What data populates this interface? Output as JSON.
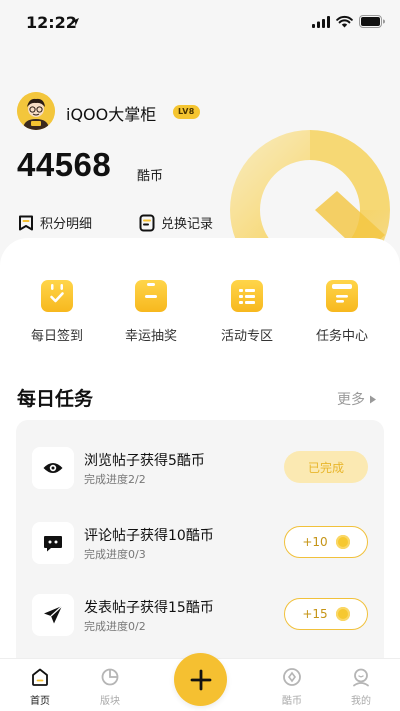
{
  "status_bar": {
    "time": "12:22"
  },
  "profile": {
    "username": "iQOO大掌柜",
    "level_badge": "LV8",
    "coin_balance": "44568",
    "coin_unit": "酷币"
  },
  "quick_links": {
    "points_detail": "积分明细",
    "redeem_history": "兑换记录"
  },
  "features": [
    {
      "label": "每日签到",
      "icon": "calendar-check-icon"
    },
    {
      "label": "幸运抽奖",
      "icon": "gift-box-icon"
    },
    {
      "label": "活动专区",
      "icon": "activity-grid-icon"
    },
    {
      "label": "任务中心",
      "icon": "task-list-icon"
    }
  ],
  "daily_tasks": {
    "title": "每日任务",
    "more_label": "更多",
    "items": [
      {
        "title": "浏览帖子获得5酷币",
        "progress": "完成进度2/2",
        "button": "已完成",
        "state": "done",
        "icon": "eye-icon"
      },
      {
        "title": "评论帖子获得10酷币",
        "progress": "完成进度0/3",
        "button": "+10",
        "state": "pending",
        "icon": "comment-icon"
      },
      {
        "title": "发表帖子获得15酷币",
        "progress": "完成进度0/2",
        "button": "+15",
        "state": "pending",
        "icon": "send-icon"
      }
    ]
  },
  "bottom_nav": {
    "home": "首页",
    "boards": "版块",
    "coins": "酷币",
    "mine": "我的",
    "active": "home"
  },
  "colors": {
    "accent": "#f5c031",
    "done_bg": "#fbe9b2",
    "done_text": "#e8b62c"
  }
}
